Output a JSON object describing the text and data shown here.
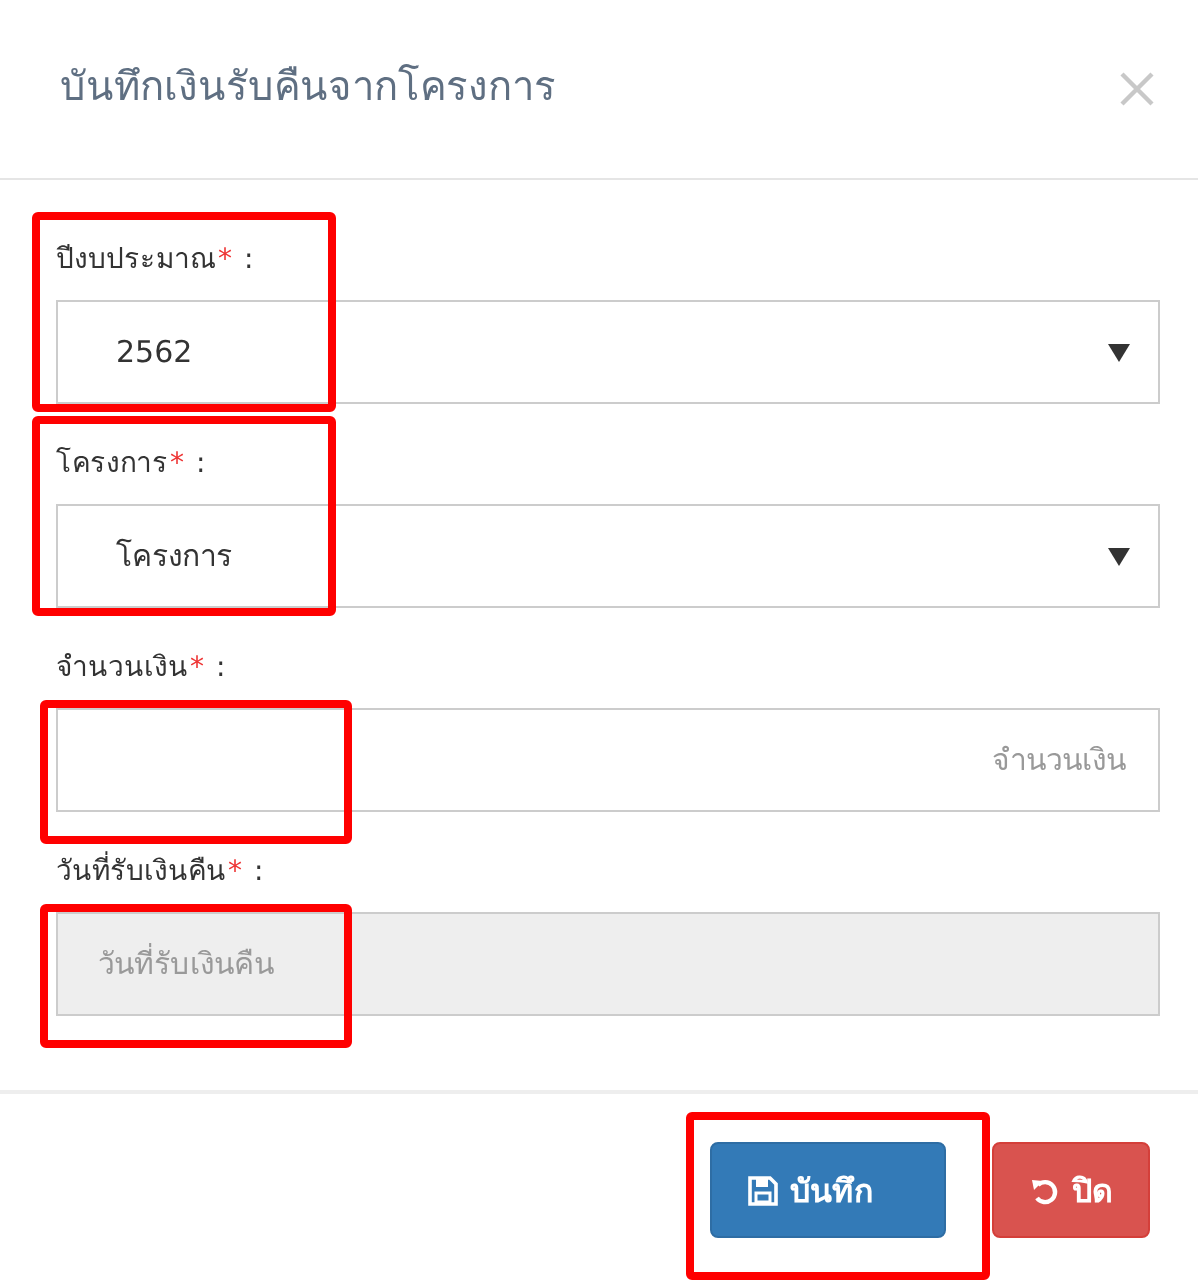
{
  "dialog": {
    "title": "บันทึกเงินรับคืนจากโครงการ"
  },
  "fields": [
    {
      "kind": "select",
      "label": "ปีงบประมาณ",
      "required_mark": "*",
      "separator": ":",
      "value": "2562",
      "disabled": false,
      "highlighted": true,
      "highlight_includes_label": true
    },
    {
      "kind": "select",
      "label": "โครงการ",
      "required_mark": "*",
      "separator": ":",
      "value": "โครงการ",
      "disabled": false,
      "highlighted": true,
      "highlight_includes_label": true
    },
    {
      "kind": "amount",
      "label": "จำนวนเงิน",
      "required_mark": "*",
      "separator": ":",
      "placeholder": "จำนวนเงิน",
      "disabled": false,
      "highlighted": true,
      "highlight_includes_label": false
    },
    {
      "kind": "date",
      "label": "วันที่รับเงินคืน",
      "required_mark": "*",
      "separator": ":",
      "placeholder": "วันที่รับเงินคืน",
      "disabled": true,
      "highlighted": true,
      "highlight_includes_label": false
    }
  ],
  "buttons": [
    {
      "kind": "save",
      "label": "บันทึก",
      "highlight": true
    },
    {
      "kind": "close",
      "label": "ปิด",
      "highlight": false
    }
  ]
}
